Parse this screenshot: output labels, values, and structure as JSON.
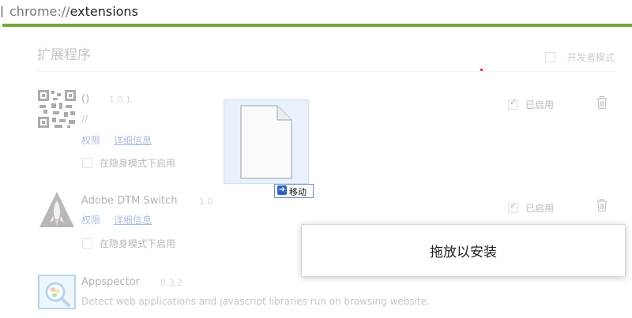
{
  "address_bar": {
    "scheme": "chrome://",
    "path": "extensions"
  },
  "page": {
    "title": "扩展程序",
    "developer_mode_label": "开发者模式"
  },
  "extensions": [
    {
      "name": "()",
      "version": "1.0.1",
      "description": "//",
      "permissions_label": "权限",
      "details_label": "详细信息",
      "incognito_label": "在隐身模式下启用",
      "enabled_label": "已启用",
      "icon": "qr-code-icon"
    },
    {
      "name": "Adobe DTM Switch",
      "version": "1.0",
      "permissions_label": "权限",
      "details_label": "详细信息",
      "incognito_label": "在隐身模式下启用",
      "enabled_label": "已启用",
      "icon": "rocket-icon"
    },
    {
      "name": "Appspector",
      "version": "0.3.2",
      "description": "Detect web applications and javascript libraries run on browsing website.",
      "icon": "magnifier-icon"
    }
  ],
  "drag_overlay": {
    "tooltip": "移动",
    "icon": "file-icon"
  },
  "drop_zone": {
    "text": "拖放以安装"
  },
  "colors": {
    "accent_line": "#76a73b",
    "link": "#1a4ea8"
  }
}
